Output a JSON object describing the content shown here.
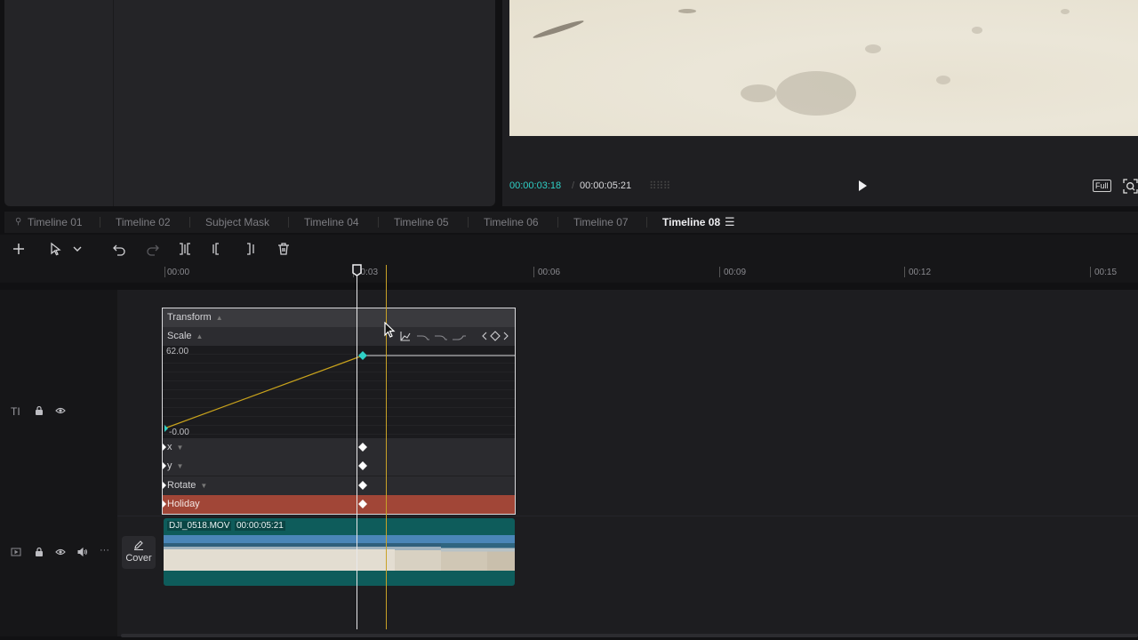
{
  "viewer": {
    "current_time": "00:00:03:18",
    "separator": "/",
    "total_time": "00:00:05:21",
    "full_label": "Full"
  },
  "tabs": [
    {
      "label": "Timeline 01",
      "active": false
    },
    {
      "label": "Timeline 02",
      "active": false
    },
    {
      "label": "Subject Mask",
      "active": false
    },
    {
      "label": "Timeline 04",
      "active": false
    },
    {
      "label": "Timeline 05",
      "active": false
    },
    {
      "label": "Timeline 06",
      "active": false
    },
    {
      "label": "Timeline 07",
      "active": false
    },
    {
      "label": "Timeline 08",
      "active": true
    }
  ],
  "ruler": {
    "labels": [
      "00:00",
      "00:03",
      "00:06",
      "00:09",
      "00:12",
      "00:15"
    ]
  },
  "keyframes": {
    "section_title": "Transform",
    "property": "Scale",
    "max_value": "62.00",
    "min_value": "-0.00",
    "rows": {
      "x": "x",
      "y": "y",
      "rotate": "Rotate",
      "text_track": "Holiday"
    }
  },
  "clip": {
    "name": "DJI_0518.MOV",
    "duration": "00:00:05:21"
  },
  "track_header": {
    "cover_label": "Cover"
  },
  "colors": {
    "accent_teal": "#2fd0c6",
    "clip_teal": "#0e5c5b",
    "text_track_red": "#a14637",
    "cursor_gold": "#c9a227",
    "curve_gold": "#c8a21c"
  }
}
